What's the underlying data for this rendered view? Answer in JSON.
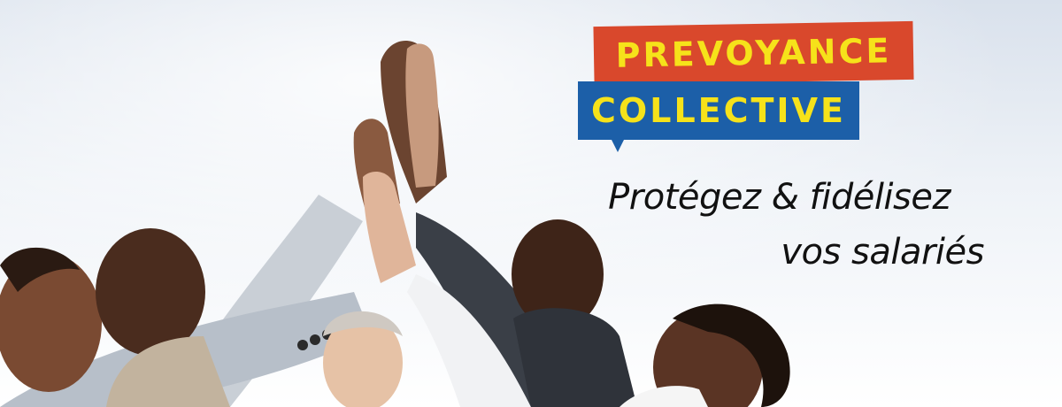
{
  "banner": {
    "badge_top": "PREVOYANCE",
    "badge_bottom": "COLLECTIVE",
    "tagline_line1": "Protégez & fidélisez",
    "tagline_line2": "vos salariés"
  },
  "colors": {
    "badge_red": "#d9482c",
    "badge_blue": "#1c5fa8",
    "badge_text": "#f6e21a",
    "tagline_text": "#111111",
    "background": "#e6ecf3"
  },
  "icons": [
    "high-five-photo"
  ]
}
